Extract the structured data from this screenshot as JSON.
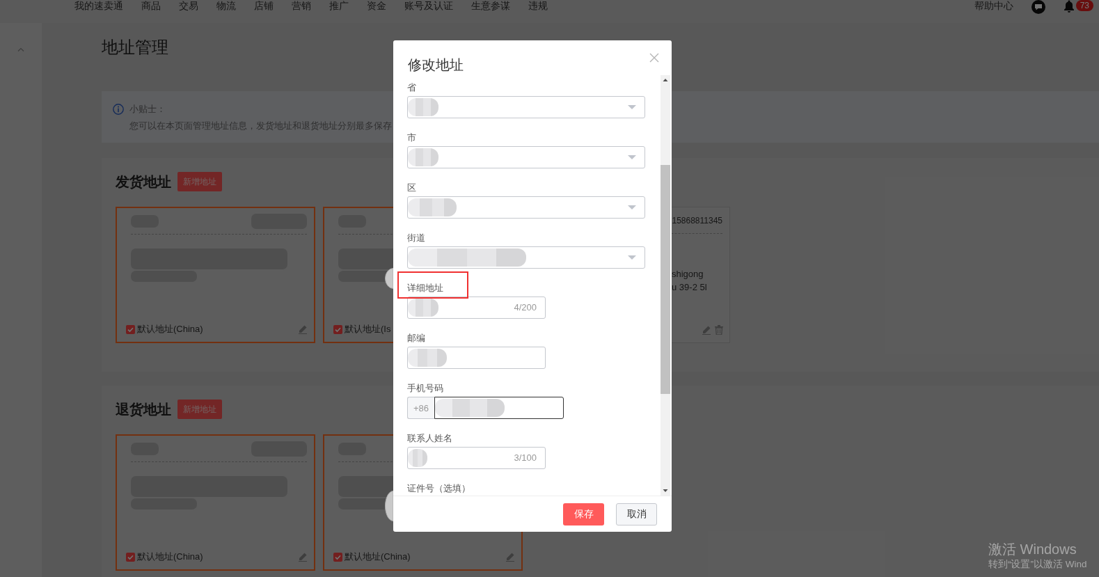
{
  "top_nav": {
    "items": [
      "我的速卖通",
      "商品",
      "交易",
      "物流",
      "店铺",
      "营销",
      "推广",
      "资金",
      "账号及认证",
      "生意参谋",
      "违规"
    ],
    "help": "帮助中心",
    "notification_count": "73"
  },
  "page": {
    "title": "地址管理",
    "tip": {
      "title": "小贴士：",
      "text": "您可以在本页面管理地址信息，发货地址和退货地址分别最多保存"
    }
  },
  "sections": [
    {
      "title": "发货地址",
      "add_button": "新增地址",
      "cards": [
        {
          "default": true,
          "blurred": true,
          "checked": true,
          "label": "默认地址(China)"
        },
        {
          "default": true,
          "blurred": true,
          "checked": true,
          "label": "默认地址(Is"
        },
        {
          "default": false,
          "blurred": false,
          "phone": "15868811345",
          "address_lines": [
            "shigong",
            "u 39-2 5l"
          ]
        }
      ]
    },
    {
      "title": "退货地址",
      "add_button": "新增地址",
      "cards": [
        {
          "default": true,
          "blurred": true,
          "checked": true,
          "label": "默认地址(China)"
        },
        {
          "default": true,
          "blurred": true,
          "checked": true,
          "label": "默认地址(China)"
        }
      ]
    }
  ],
  "modal": {
    "title": "修改地址",
    "fields": [
      {
        "kind": "select",
        "label": "省",
        "blurred": true,
        "focused": false,
        "highlighted": false
      },
      {
        "kind": "select",
        "label": "市",
        "blurred": true,
        "focused": false,
        "highlighted": false
      },
      {
        "kind": "select",
        "label": "区",
        "blurred": true,
        "focused": false,
        "highlighted": false
      },
      {
        "kind": "select",
        "label": "街道",
        "blurred": true,
        "focused": false,
        "highlighted": false
      },
      {
        "kind": "text",
        "label": "详细地址",
        "blurred": true,
        "focused": false,
        "highlighted": true,
        "counter": "4/200"
      },
      {
        "kind": "text",
        "label": "邮编",
        "blurred": true,
        "focused": false,
        "highlighted": false
      },
      {
        "kind": "phone",
        "label": "手机号码",
        "prefix": "+86",
        "blurred": true,
        "focused": true,
        "highlighted": false
      },
      {
        "kind": "text",
        "label": "联系人姓名",
        "blurred": true,
        "focused": false,
        "highlighted": false,
        "counter": "3/100"
      },
      {
        "kind": "label",
        "label": "证件号（选填）",
        "highlighted": false
      }
    ],
    "buttons": [
      {
        "kind": "primary",
        "label": "保存"
      },
      {
        "kind": "secondary",
        "label": "取消"
      }
    ]
  },
  "os_notice": {
    "title": "激活 Windows",
    "text": "转到“设置”以激活 Wind"
  }
}
